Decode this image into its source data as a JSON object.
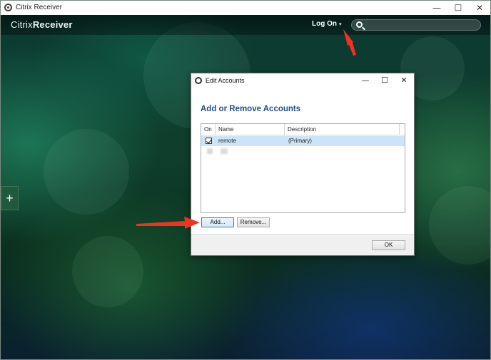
{
  "window": {
    "title": "Citrix Receiver",
    "controls": {
      "minimize": "—",
      "maximize": "☐",
      "close": "✕"
    }
  },
  "topbar": {
    "brand_light": "Citrix",
    "brand_strong": "Receiver",
    "logon_label": "Log On",
    "caret": "▾",
    "search_placeholder": ""
  },
  "sidebar": {
    "add_tab_label": "+"
  },
  "dialog": {
    "title": "Edit Accounts",
    "controls": {
      "minimize": "—",
      "maximize": "☐",
      "close": "✕"
    },
    "heading": "Add or Remove Accounts",
    "columns": [
      "On",
      "Name",
      "Description"
    ],
    "rows": [
      {
        "on": true,
        "name": "remote",
        "description": "(Primary)",
        "selected": true
      }
    ],
    "add_button": "Add...",
    "remove_button": "Remove...",
    "ok_button": "OK"
  },
  "colors": {
    "heading": "#1f4f8a",
    "selection": "#cce4f7",
    "annotation_arrow": "#f0321e"
  }
}
